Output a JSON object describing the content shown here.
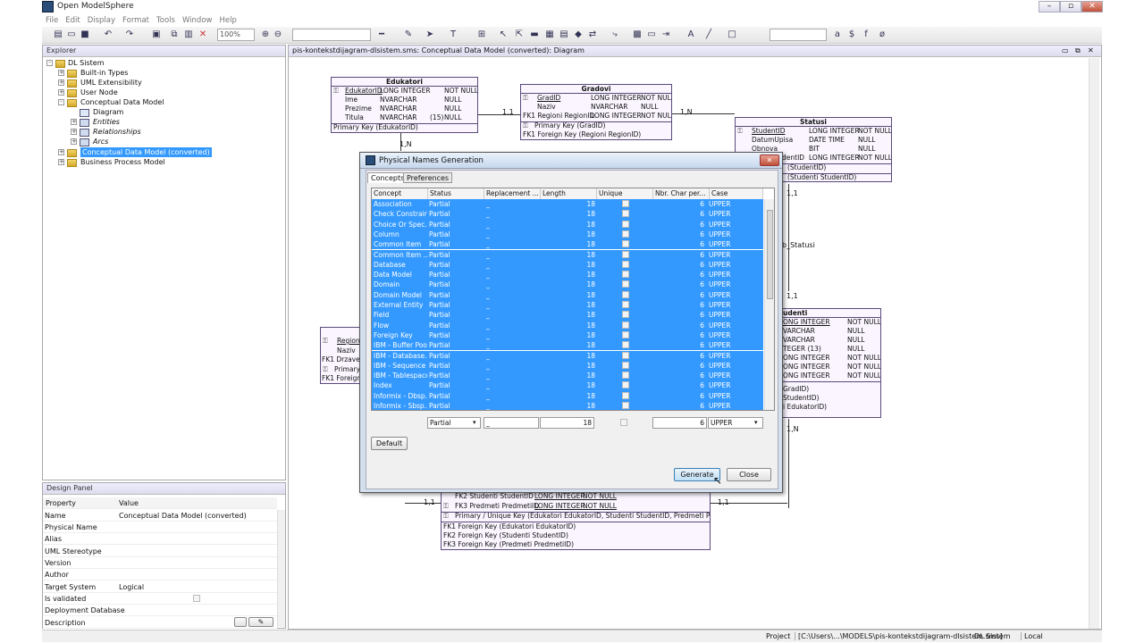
{
  "app": {
    "title": "Open ModelSphere"
  },
  "menu": [
    "File",
    "Edit",
    "Display",
    "Format",
    "Tools",
    "Window",
    "Help"
  ],
  "toolbar": {
    "zoom": "100%"
  },
  "explorer": {
    "title": "Explorer",
    "items": [
      {
        "label": "DL Sistem"
      },
      {
        "label": "Built-in Types"
      },
      {
        "label": "UML Extensibility"
      },
      {
        "label": "User Node"
      },
      {
        "label": "Conceptual Data Model"
      },
      {
        "label": "Diagram"
      },
      {
        "label": "Entities"
      },
      {
        "label": "Relationships"
      },
      {
        "label": "Arcs"
      },
      {
        "label": "Conceptual Data Model (converted)"
      },
      {
        "label": "Business Process Model"
      }
    ]
  },
  "design": {
    "title": "Design Panel",
    "col_property": "Property",
    "col_value": "Value",
    "rows": [
      {
        "p": "Name",
        "v": "Conceptual Data Model (converted)"
      },
      {
        "p": "Physical Name",
        "v": ""
      },
      {
        "p": "Alias",
        "v": ""
      },
      {
        "p": "UML Stereotype",
        "v": ""
      },
      {
        "p": "Version",
        "v": ""
      },
      {
        "p": "Author",
        "v": ""
      },
      {
        "p": "Target System",
        "v": "Logical"
      },
      {
        "p": "Is validated",
        "v": ""
      },
      {
        "p": "Deployment Database",
        "v": ""
      },
      {
        "p": "Description",
        "v": ""
      }
    ]
  },
  "diagram": {
    "tab": "pis-kontekstdijagram-dlsistem.sms: Conceptual Data Model (converted): Diagram",
    "edukatori": {
      "title": "Edukatori",
      "rows": [
        [
          "EdukatorID",
          "LONG INTEGER",
          "",
          "NOT NULL"
        ],
        [
          "Ime",
          "NVARCHAR",
          "",
          "NULL"
        ],
        [
          "Prezime",
          "NVARCHAR",
          "",
          "NULL"
        ],
        [
          "Titula",
          "NVARCHAR",
          "(15)",
          "NULL"
        ]
      ],
      "key": "Primary Key (EdukatorID)"
    },
    "gradovi": {
      "title": "Gradovi",
      "rows": [
        [
          "GradID",
          "LONG INTEGER",
          "NOT NULL"
        ],
        [
          "Naziv",
          "NVARCHAR",
          "NULL"
        ],
        [
          "FK1 Regioni RegionID",
          "LONG INTEGER",
          "NOT NULL"
        ]
      ],
      "keys": [
        "Primary Key (GradID)",
        "FK1 Foreign Key (Regioni RegionID)"
      ]
    },
    "statusi": {
      "title": "Statusi",
      "rows": [
        [
          "StudentID",
          "LONG INTEGER",
          "NOT NULL"
        ],
        [
          "DatumUpisa",
          "DATE TIME",
          "NULL"
        ],
        [
          "Obnova",
          "BIT",
          "NULL"
        ],
        [
          "dentID",
          "LONG INTEGER",
          "NOT NULL"
        ]
      ],
      "keys": [
        "(StudentID)",
        "(Studenti StudentID)"
      ]
    },
    "studenti": {
      "title": "udenti",
      "rows": [
        [
          "ONG INTEGER",
          "NOT NULL"
        ],
        [
          "VARCHAR",
          "NULL"
        ],
        [
          "VARCHAR",
          "NULL"
        ],
        [
          "TEGER     (13)",
          "NULL"
        ],
        [
          "ONG INTEGER",
          "NOT NULL"
        ],
        [
          "ONG INTEGER",
          "NOT NULL"
        ],
        [
          "ONG INTEGER",
          "NOT NULL"
        ]
      ],
      "keys": [
        "GradID)",
        "StudentID)",
        "i EdukatorID)"
      ]
    },
    "regioni": {
      "rows": [
        "RegionI",
        "Naziv",
        "FK1 Drzave",
        "Primary",
        "FK1 Foreign"
      ]
    },
    "assoc": {
      "rows": [
        [
          "FK2 Studenti StudentID",
          "LONG INTEGER",
          "NOT NULL"
        ],
        [
          "FK3 Predmeti PredmetiID",
          "LONG INTEGER",
          "NOT NULL"
        ]
      ],
      "keys": [
        "Primary / Unique Key (Edukatori EdukatorID, Studenti StudentID, Predmeti PredmetiID)",
        "FK1 Foreign Key (Edukatori EdukatorID)",
        "FK2 Foreign Key (Studenti StudentID)",
        "FK3 Foreign Key (Predmeti PredmetiID)"
      ]
    },
    "cards": [
      "1,1",
      "1,N",
      "1,N",
      "1,1",
      "b_Statusi",
      "1,1",
      "1,N",
      "1,1",
      "1,1"
    ]
  },
  "dialog": {
    "title": "Physical Names Generation",
    "tabs": [
      "Concepts",
      "Preferences"
    ],
    "columns": [
      "Concept",
      "Status",
      "Replacement ...",
      "Length",
      "Unique",
      "Nbr. Char per...",
      "Case"
    ],
    "rows": [
      [
        "Association",
        "Partial",
        "_",
        "18",
        "6",
        "UPPER"
      ],
      [
        "Check Constraint",
        "Partial",
        "_",
        "18",
        "6",
        "UPPER"
      ],
      [
        "Choice Or Spec...",
        "Partial",
        "_",
        "18",
        "6",
        "UPPER"
      ],
      [
        "Column",
        "Partial",
        "_",
        "18",
        "6",
        "UPPER"
      ],
      [
        "Common Item",
        "Partial",
        "_",
        "18",
        "6",
        "UPPER"
      ],
      [
        "Common Item ...",
        "Partial",
        "_",
        "18",
        "6",
        "UPPER"
      ],
      [
        "Database",
        "Partial",
        "_",
        "18",
        "6",
        "UPPER"
      ],
      [
        "Data Model",
        "Partial",
        "_",
        "18",
        "6",
        "UPPER"
      ],
      [
        "Domain",
        "Partial",
        "_",
        "18",
        "6",
        "UPPER"
      ],
      [
        "Domain Model",
        "Partial",
        "_",
        "18",
        "6",
        "UPPER"
      ],
      [
        "External Entity",
        "Partial",
        "_",
        "18",
        "6",
        "UPPER"
      ],
      [
        "Field",
        "Partial",
        "_",
        "18",
        "6",
        "UPPER"
      ],
      [
        "Flow",
        "Partial",
        "_",
        "18",
        "6",
        "UPPER"
      ],
      [
        "Foreign Key",
        "Partial",
        "_",
        "18",
        "6",
        "UPPER"
      ],
      [
        "IBM - Buffer Pool",
        "Partial",
        "_",
        "18",
        "6",
        "UPPER"
      ],
      [
        "IBM - Database...",
        "Partial",
        "_",
        "18",
        "6",
        "UPPER"
      ],
      [
        "IBM - Sequence",
        "Partial",
        "_",
        "18",
        "6",
        "UPPER"
      ],
      [
        "IBM - Tablespace",
        "Partial",
        "_",
        "18",
        "6",
        "UPPER"
      ],
      [
        "Index",
        "Partial",
        "_",
        "18",
        "6",
        "UPPER"
      ],
      [
        "Informix - Dbsp...",
        "Partial",
        "_",
        "18",
        "6",
        "UPPER"
      ],
      [
        "Informix - Sbsp...",
        "Partial",
        "_",
        "18",
        "6",
        "UPPER"
      ]
    ],
    "editor": {
      "status": "Partial",
      "replacement": "_",
      "length": "18",
      "nbr": "6",
      "case": "UPPER"
    },
    "default_label": "Default",
    "generate_label": "Generate",
    "close_label": "Close"
  },
  "status": {
    "project_label": "Project",
    "path": "[C:\\Users\\...\\MODELS\\pis-kontekstdijagram-dlsistem.sms]",
    "project": "DL Sistem",
    "mode": "Local"
  }
}
